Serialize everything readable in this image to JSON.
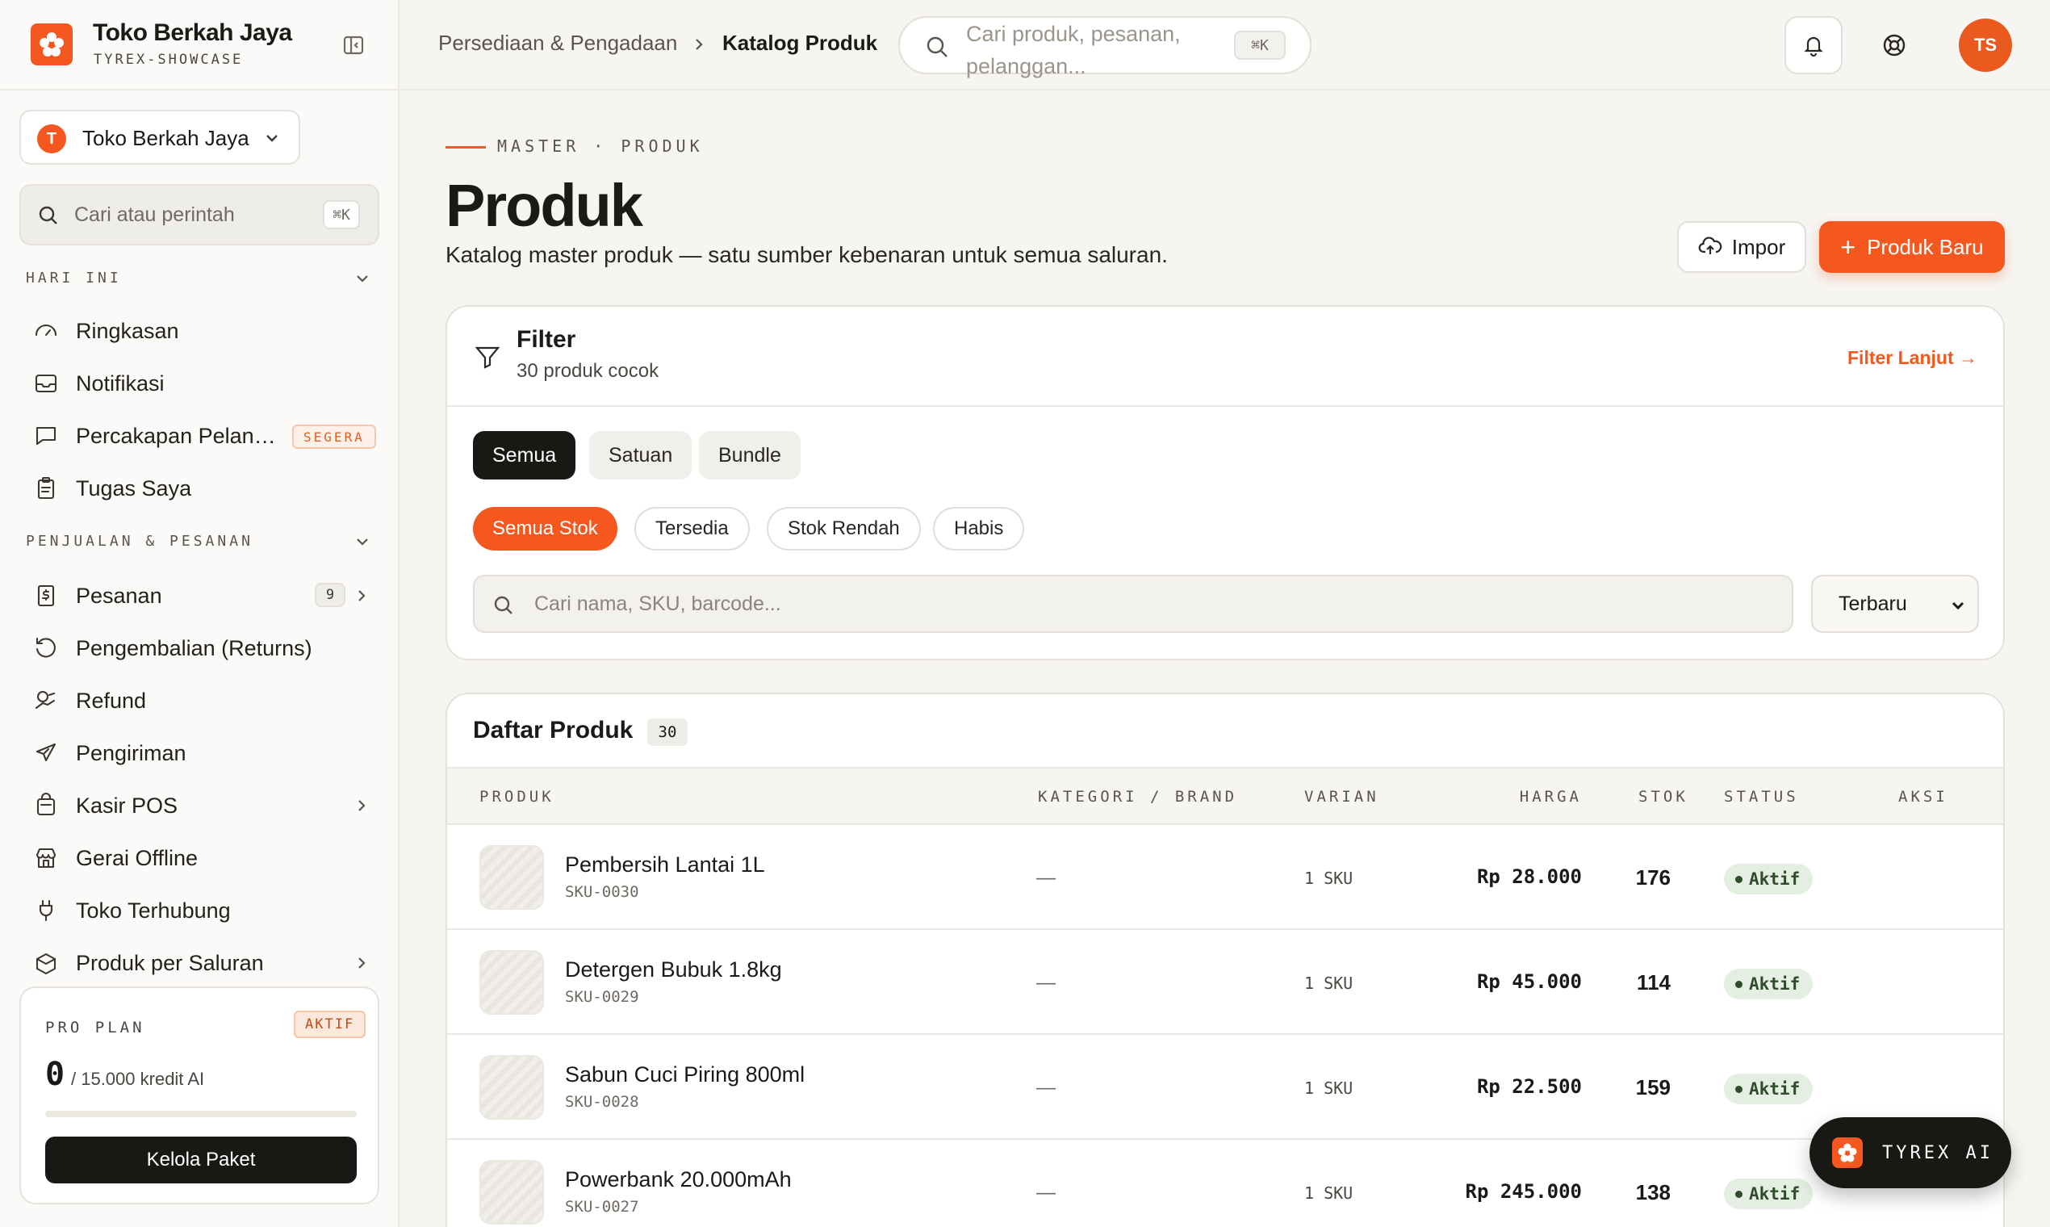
{
  "brand": {
    "name": "Toko Berkah Jaya",
    "sub": "TYREX-SHOWCASE",
    "accent": "#f4581f"
  },
  "store": {
    "initial": "T",
    "name": "Toko Berkah Jaya"
  },
  "side_search": {
    "placeholder": "Cari atau perintah",
    "shortcut": "⌘K"
  },
  "sections": {
    "today": "HARI INI",
    "sales": "PENJUALAN & PESANAN"
  },
  "nav_today": [
    {
      "label": "Ringkasan",
      "icon": "gauge-icon"
    },
    {
      "label": "Notifikasi",
      "icon": "inbox-icon"
    },
    {
      "label": "Percakapan Pelanggan",
      "icon": "chat-icon",
      "badge": "SEGERA"
    },
    {
      "label": "Tugas Saya",
      "icon": "clipboard-icon"
    }
  ],
  "nav_sales": [
    {
      "label": "Pesanan",
      "icon": "receipt-icon",
      "count": "9",
      "arrow": true
    },
    {
      "label": "Pengembalian (Returns)",
      "icon": "return-icon"
    },
    {
      "label": "Refund",
      "icon": "refund-icon"
    },
    {
      "label": "Pengiriman",
      "icon": "plane-icon"
    },
    {
      "label": "Kasir POS",
      "icon": "bag-icon",
      "arrow": true
    },
    {
      "label": "Gerai Offline",
      "icon": "store-icon"
    },
    {
      "label": "Toko Terhubung",
      "icon": "plug-icon"
    },
    {
      "label": "Produk per Saluran",
      "icon": "box-icon",
      "arrow": true
    }
  ],
  "plan": {
    "label": "PRO PLAN",
    "badge": "AKTIF",
    "used": "0",
    "of": "/ 15.000 kredit AI",
    "usage_fraction": 0,
    "button": "Kelola Paket"
  },
  "topbar": {
    "crumb_parent": "Persediaan & Pengadaan",
    "crumb_current": "Katalog Produk",
    "search_placeholder": "Cari produk, pesanan, pelanggan...",
    "search_shortcut": "⌘K",
    "avatar": "TS"
  },
  "header": {
    "eyebrow": "MASTER · PRODUK",
    "title": "Produk",
    "description": "Katalog master produk — satu sumber kebenaran untuk semua saluran.",
    "import_label": "Impor",
    "new_label": "Produk Baru"
  },
  "filter": {
    "title": "Filter",
    "subtitle": "30 produk cocok",
    "advanced": "Filter Lanjut →",
    "types": [
      "Semua",
      "Satuan",
      "Bundle"
    ],
    "stock": [
      "Semua Stok",
      "Tersedia",
      "Stok Rendah",
      "Habis"
    ],
    "search_placeholder": "Cari nama, SKU, barcode...",
    "sort": "Terbaru"
  },
  "list": {
    "title": "Daftar Produk",
    "count": "30",
    "columns": [
      "PRODUK",
      "KATEGORI / BRAND",
      "VARIAN",
      "HARGA",
      "STOK",
      "STATUS",
      "AKSI"
    ],
    "rows": [
      {
        "name": "Pembersih Lantai 1L",
        "sku": "SKU-0030",
        "category": "—",
        "variant": "1 SKU",
        "price": "Rp 28.000",
        "stock": "176",
        "status": "Aktif"
      },
      {
        "name": "Detergen Bubuk 1.8kg",
        "sku": "SKU-0029",
        "category": "—",
        "variant": "1 SKU",
        "price": "Rp 45.000",
        "stock": "114",
        "status": "Aktif"
      },
      {
        "name": "Sabun Cuci Piring 800ml",
        "sku": "SKU-0028",
        "category": "—",
        "variant": "1 SKU",
        "price": "Rp 22.500",
        "stock": "159",
        "status": "Aktif"
      },
      {
        "name": "Powerbank 20.000mAh",
        "sku": "SKU-0027",
        "category": "—",
        "variant": "1 SKU",
        "price": "Rp 245.000",
        "stock": "138",
        "status": "Aktif"
      }
    ]
  },
  "ai": {
    "label": "TYREX AI"
  }
}
